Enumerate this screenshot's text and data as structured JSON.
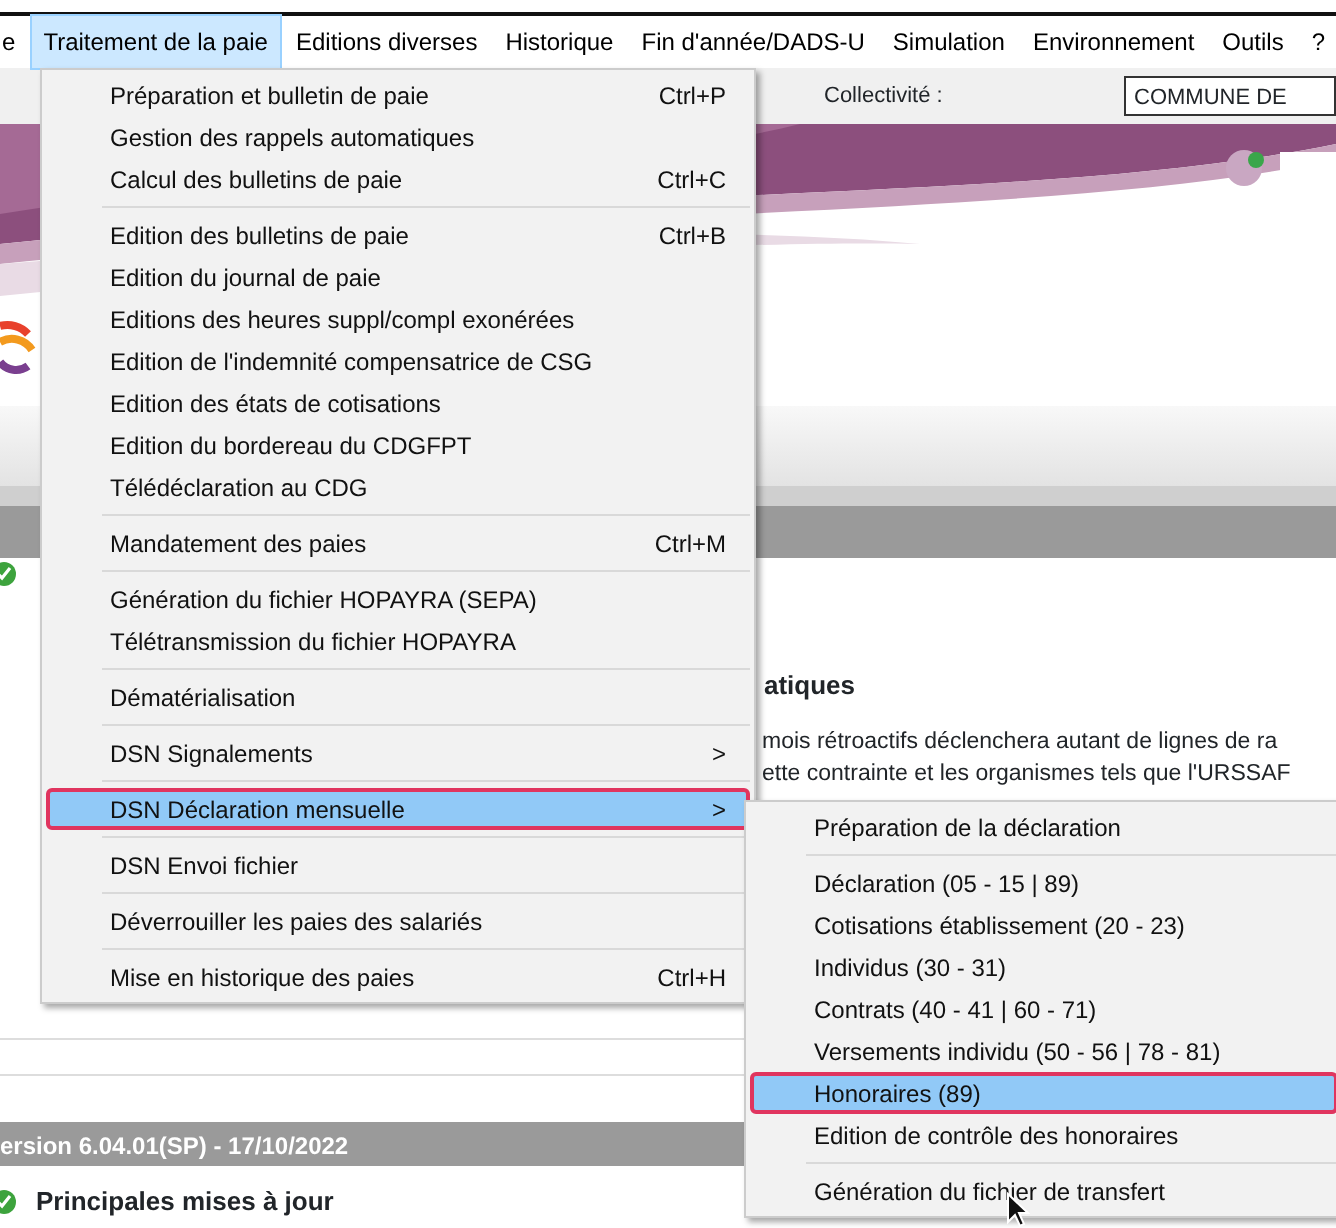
{
  "menubar": [
    {
      "label": "e",
      "selected": false
    },
    {
      "label": "Traitement de la paie",
      "selected": true
    },
    {
      "label": "Editions diverses",
      "selected": false
    },
    {
      "label": "Historique",
      "selected": false
    },
    {
      "label": "Fin d'année/DADS-U",
      "selected": false
    },
    {
      "label": "Simulation",
      "selected": false
    },
    {
      "label": "Environnement",
      "selected": false
    },
    {
      "label": "Outils",
      "selected": false
    },
    {
      "label": "?",
      "selected": false
    }
  ],
  "toolbar": {
    "label": "Collectivité :",
    "value": "COMMUNE DE"
  },
  "content": {
    "heading": "atiques",
    "lines": [
      "mois rétroactifs déclenchera autant de lignes de ra",
      "ette contrainte et les organismes tels que l'URSSAF"
    ]
  },
  "version_bar": "ersion 6.04.01(SP) - 17/10/2022",
  "section_title": "Principales mises à jour",
  "menu": {
    "items": [
      {
        "kind": "item",
        "label": "Préparation et bulletin de paie",
        "shortcut": "Ctrl+P",
        "selected": false,
        "outlined": false
      },
      {
        "kind": "item",
        "label": "Gestion des rappels automatiques",
        "selected": false,
        "outlined": false
      },
      {
        "kind": "item",
        "label": "Calcul des bulletins de paie",
        "shortcut": "Ctrl+C",
        "selected": false,
        "outlined": false
      },
      {
        "kind": "separator"
      },
      {
        "kind": "item",
        "label": "Edition des bulletins de paie",
        "shortcut": "Ctrl+B",
        "selected": false,
        "outlined": false
      },
      {
        "kind": "item",
        "label": "Edition du journal de paie",
        "selected": false,
        "outlined": false
      },
      {
        "kind": "item",
        "label": "Editions des heures suppl/compl exonérées",
        "selected": false,
        "outlined": false
      },
      {
        "kind": "item",
        "label": "Edition de l'indemnité compensatrice de CSG",
        "selected": false,
        "outlined": false
      },
      {
        "kind": "item",
        "label": "Edition des états de cotisations",
        "selected": false,
        "outlined": false
      },
      {
        "kind": "item",
        "label": "Edition du bordereau du CDGFPT",
        "selected": false,
        "outlined": false
      },
      {
        "kind": "item",
        "label": "Télédéclaration au CDG",
        "selected": false,
        "outlined": false
      },
      {
        "kind": "separator"
      },
      {
        "kind": "item",
        "label": "Mandatement des paies",
        "shortcut": "Ctrl+M",
        "selected": false,
        "outlined": false
      },
      {
        "kind": "separator"
      },
      {
        "kind": "item",
        "label": "Génération du fichier HOPAYRA (SEPA)",
        "selected": false,
        "outlined": false
      },
      {
        "kind": "item",
        "label": "Télétransmission du fichier HOPAYRA",
        "selected": false,
        "outlined": false
      },
      {
        "kind": "separator"
      },
      {
        "kind": "item",
        "label": "Dématérialisation",
        "selected": false,
        "outlined": false
      },
      {
        "kind": "separator"
      },
      {
        "kind": "item",
        "label": "DSN Signalements",
        "arrow": ">",
        "selected": false,
        "outlined": false
      },
      {
        "kind": "separator"
      },
      {
        "kind": "item",
        "label": "DSN Déclaration mensuelle",
        "arrow": ">",
        "selected": true,
        "outlined": true
      },
      {
        "kind": "separator"
      },
      {
        "kind": "item",
        "label": "DSN Envoi fichier",
        "selected": false,
        "outlined": false
      },
      {
        "kind": "separator"
      },
      {
        "kind": "item",
        "label": "Déverrouiller les paies des salariés",
        "selected": false,
        "outlined": false
      },
      {
        "kind": "separator"
      },
      {
        "kind": "item",
        "label": "Mise en historique des paies",
        "shortcut": "Ctrl+H",
        "selected": false,
        "outlined": false
      }
    ]
  },
  "submenu": {
    "items": [
      {
        "kind": "item",
        "label": "Préparation de la déclaration",
        "selected": false,
        "outlined": false
      },
      {
        "kind": "separator"
      },
      {
        "kind": "item",
        "label": "Déclaration (05 - 15 | 89)",
        "selected": false,
        "outlined": false
      },
      {
        "kind": "item",
        "label": "Cotisations établissement (20 - 23)",
        "selected": false,
        "outlined": false
      },
      {
        "kind": "item",
        "label": "Individus (30 - 31)",
        "selected": false,
        "outlined": false
      },
      {
        "kind": "item",
        "label": "Contrats (40 - 41 | 60 - 71)",
        "selected": false,
        "outlined": false
      },
      {
        "kind": "item",
        "label": "Versements individu (50 - 56 | 78 - 81)",
        "selected": false,
        "outlined": false
      },
      {
        "kind": "item",
        "label": "Honoraires (89)",
        "selected": true,
        "outlined": true
      },
      {
        "kind": "item",
        "label": "Edition de contrôle des honoraires",
        "selected": false,
        "outlined": false
      },
      {
        "kind": "separator"
      },
      {
        "kind": "item",
        "label": "Génération du fichier de transfert",
        "selected": false,
        "outlined": false
      }
    ]
  }
}
